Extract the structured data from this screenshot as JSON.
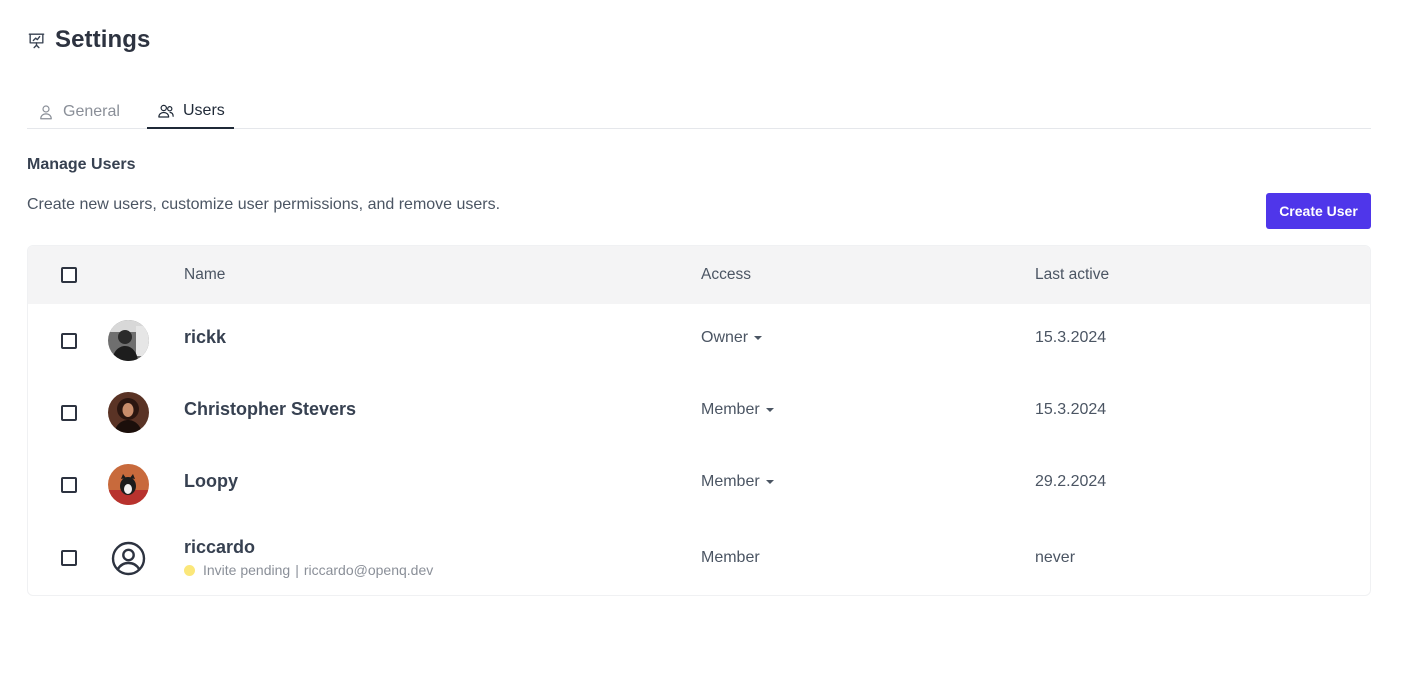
{
  "header": {
    "title": "Settings",
    "icon": "presentation-chart-icon"
  },
  "tabs": [
    {
      "label": "General",
      "icon": "user-icon",
      "active": false
    },
    {
      "label": "Users",
      "icon": "users-icon",
      "active": true
    }
  ],
  "section": {
    "title": "Manage Users",
    "description": "Create new users, customize user permissions, and remove users.",
    "create_button": "Create User"
  },
  "table": {
    "columns": [
      "Name",
      "Access",
      "Last active"
    ],
    "rows": [
      {
        "name": "rickk",
        "access": "Owner",
        "last_active": "15.3.2024",
        "has_dropdown": true
      },
      {
        "name": "Christopher Stevers",
        "access": "Member",
        "last_active": "15.3.2024",
        "has_dropdown": true
      },
      {
        "name": "Loopy",
        "access": "Member",
        "last_active": "29.2.2024",
        "has_dropdown": true
      },
      {
        "name": "riccardo",
        "access": "Member",
        "last_active": "never",
        "has_dropdown": false,
        "status": "Invite pending",
        "separator": "|",
        "email": "riccardo@openq.dev"
      }
    ]
  },
  "colors": {
    "accent": "#4f36ea",
    "pending": "#fbe77a"
  }
}
